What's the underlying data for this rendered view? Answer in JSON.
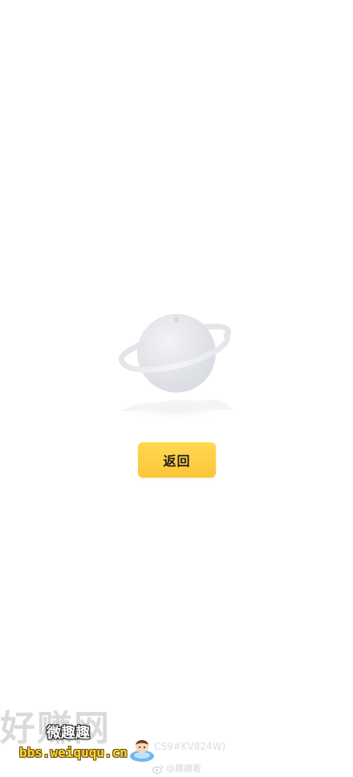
{
  "actions": {
    "back_label": "返回"
  },
  "illustration": {
    "icon": "planet-icon"
  },
  "watermark": {
    "site_text": "好赚网",
    "overlay_text": "微趣趣",
    "url": "bbs.weiququ.cn",
    "code": "CS9#KV824W)",
    "weibo_handle": "@趣趣看",
    "mascot_icon": "mascot-icon",
    "weibo_icon": "weibo-icon"
  },
  "colors": {
    "background": "#ffffff",
    "button": "#fcc63a",
    "button_text": "#1d1d1d",
    "planet": "#e6e8ec"
  }
}
